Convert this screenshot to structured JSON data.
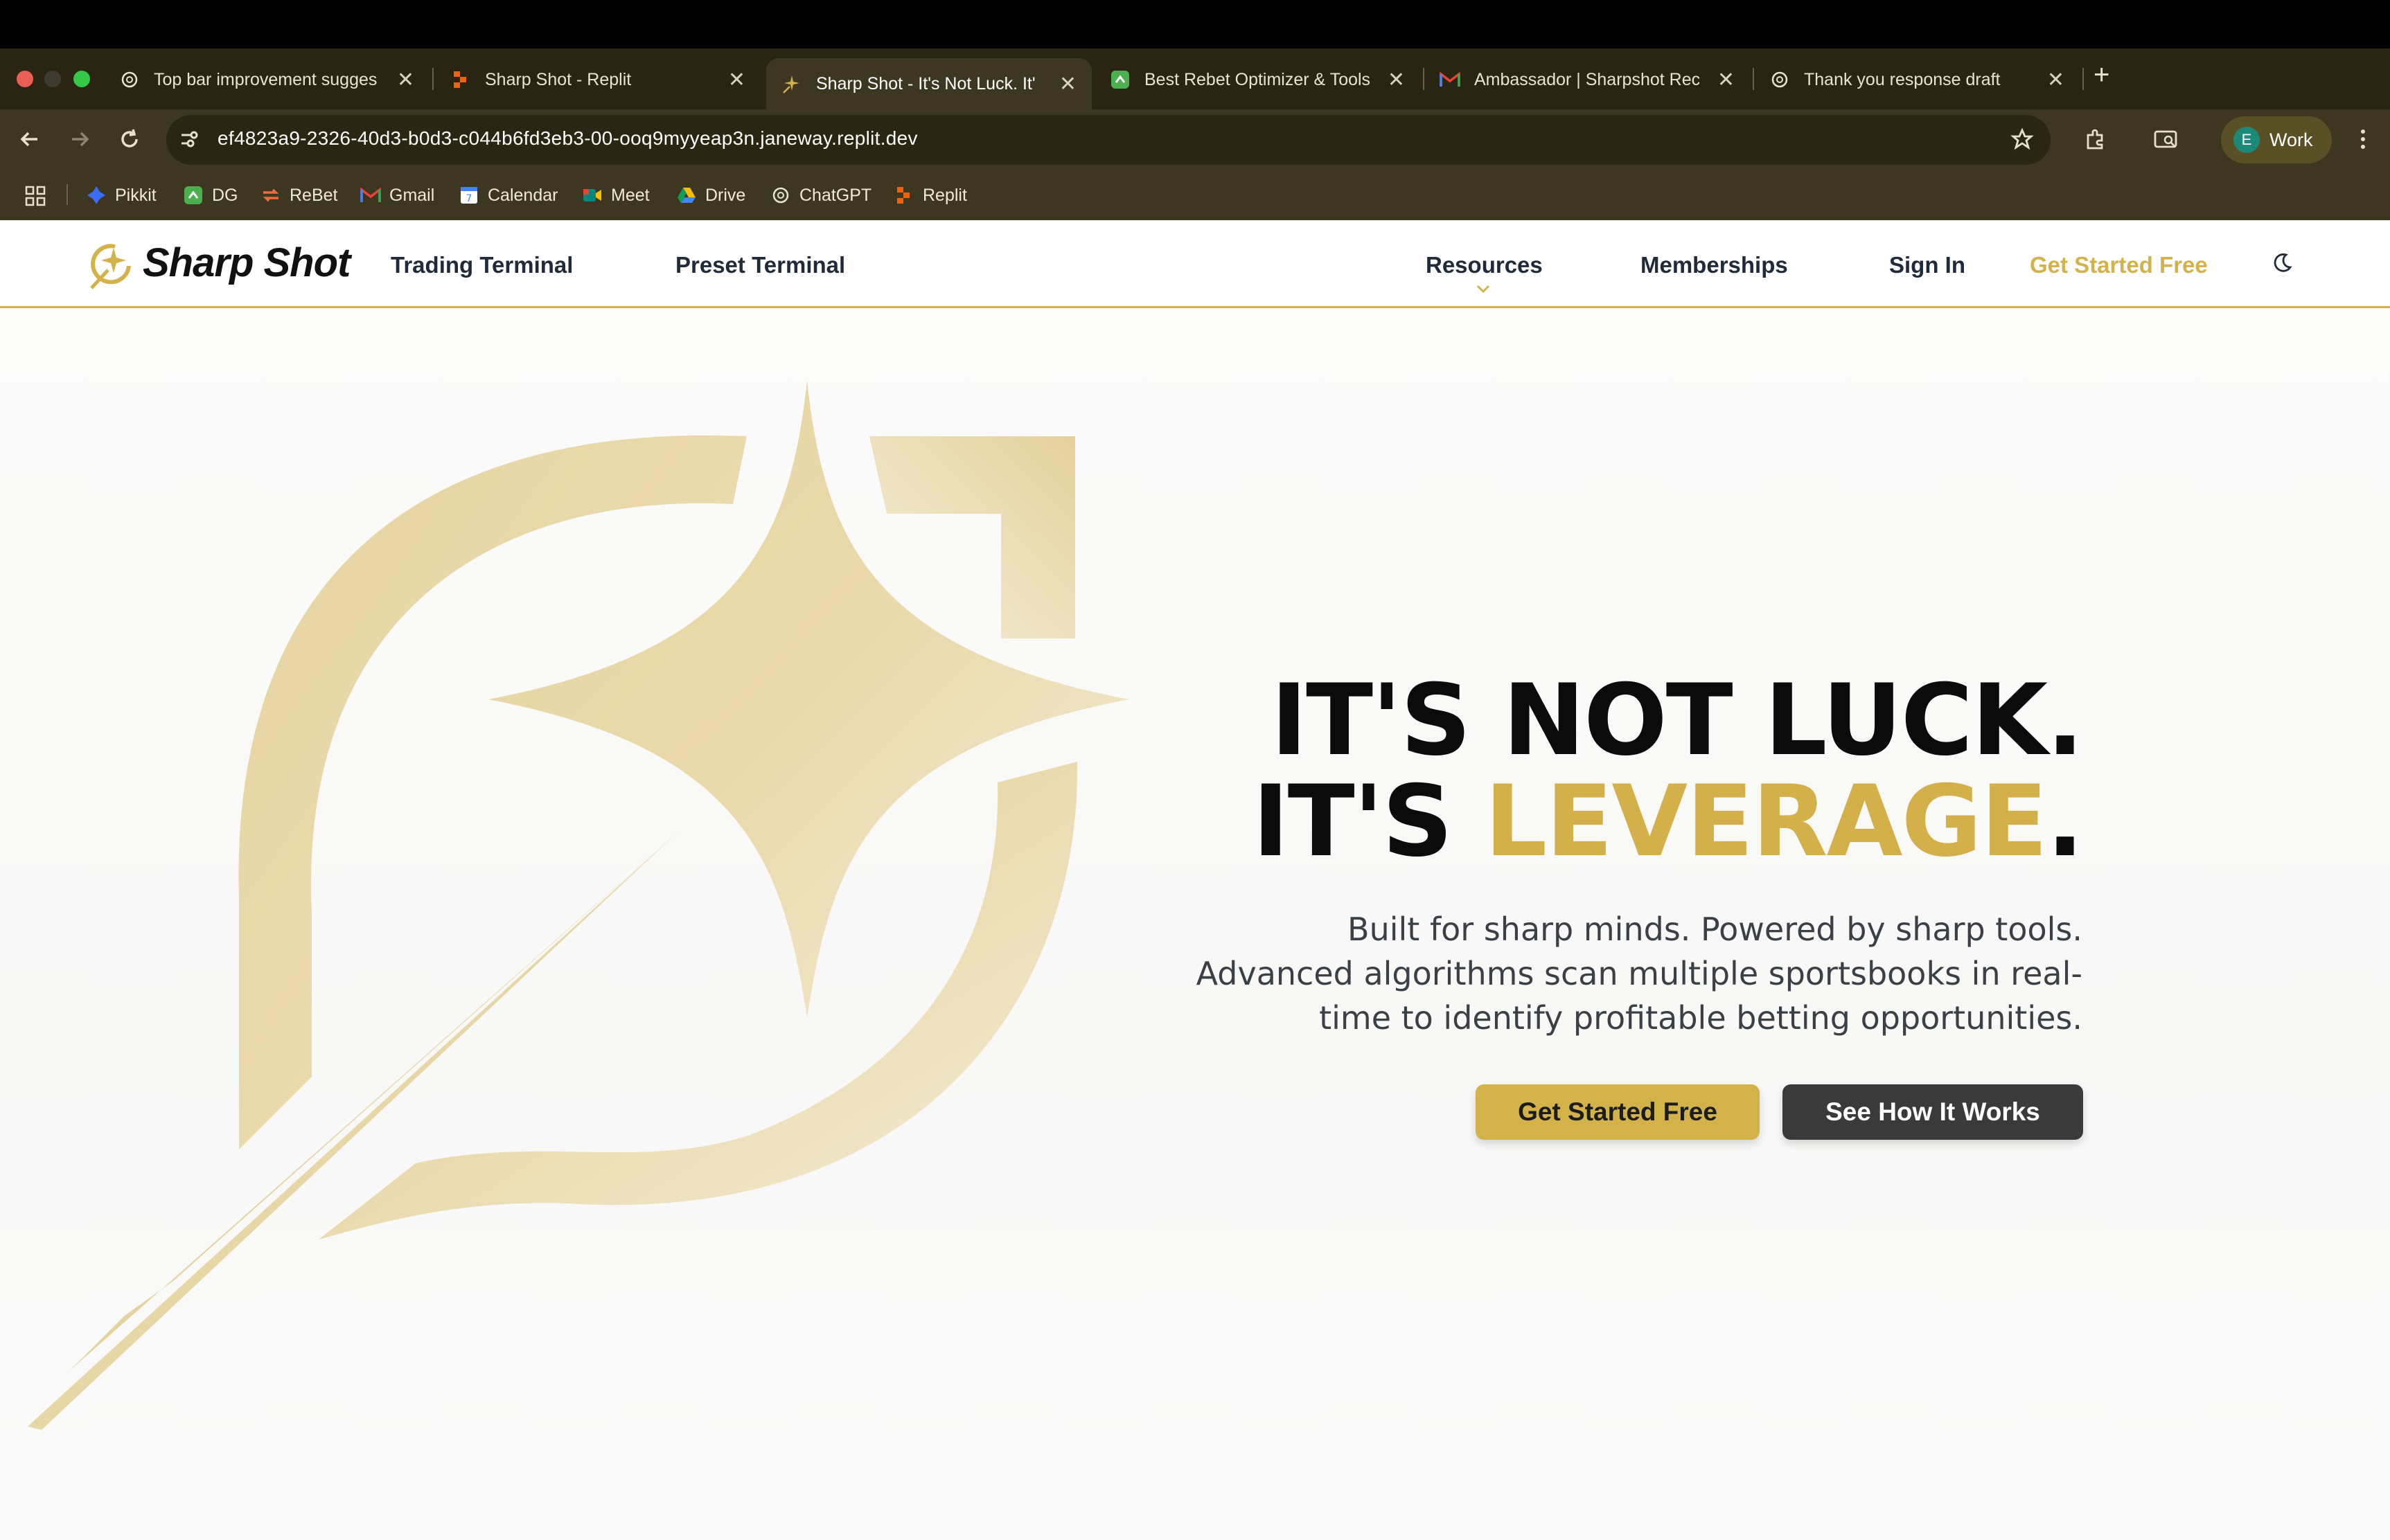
{
  "browser": {
    "tabs": [
      {
        "title": "Top bar improvement sugges",
        "icon": "openai-icon",
        "active": false
      },
      {
        "title": "Sharp Shot - Replit",
        "icon": "replit-icon",
        "active": false
      },
      {
        "title": "Sharp Shot - It's Not Luck. It'",
        "icon": "sharpshot-icon",
        "active": true
      },
      {
        "title": "Best Rebet Optimizer & Tools",
        "icon": "dg-icon",
        "active": false
      },
      {
        "title": "Ambassador | Sharpshot Rec",
        "icon": "gmail-icon",
        "active": false
      },
      {
        "title": "Thank you response draft",
        "icon": "openai-icon",
        "active": false
      }
    ],
    "url": "ef4823a9-2326-40d3-b0d3-c044b6fd3eb3-00-ooq9myyeap3n.janeway.replit.dev",
    "profile_initial": "E",
    "profile_label": "Work",
    "bookmarks": [
      {
        "label": "Pikkit",
        "icon": "pikkit-icon"
      },
      {
        "label": "DG",
        "icon": "dg-icon"
      },
      {
        "label": "ReBet",
        "icon": "rebet-icon"
      },
      {
        "label": "Gmail",
        "icon": "gmail-icon"
      },
      {
        "label": "Calendar",
        "icon": "calendar-icon"
      },
      {
        "label": "Meet",
        "icon": "meet-icon"
      },
      {
        "label": "Drive",
        "icon": "drive-icon"
      },
      {
        "label": "ChatGPT",
        "icon": "openai-icon"
      },
      {
        "label": "Replit",
        "icon": "replit-icon"
      }
    ]
  },
  "site": {
    "brand": "Sharp Shot",
    "nav_left": [
      "Trading Terminal",
      "Preset Terminal"
    ],
    "nav_right": {
      "resources": "Resources",
      "memberships": "Memberships",
      "sign_in": "Sign In",
      "get_started": "Get Started Free"
    },
    "hero": {
      "line1": "IT'S NOT LUCK.",
      "line2_prefix": "IT'S ",
      "line2_accent": "LEVERAGE",
      "line2_suffix": ".",
      "subtitle_lines": [
        "Built for sharp minds. Powered by sharp tools.",
        "Advanced algorithms scan multiple sportsbooks in real-",
        "time to identify profitable betting opportunities."
      ],
      "cta_primary": "Get Started Free",
      "cta_secondary": "See How It Works"
    },
    "colors": {
      "accent": "#d4b24a",
      "dark": "#3a3a3a",
      "text": "#1f2a3a"
    }
  }
}
